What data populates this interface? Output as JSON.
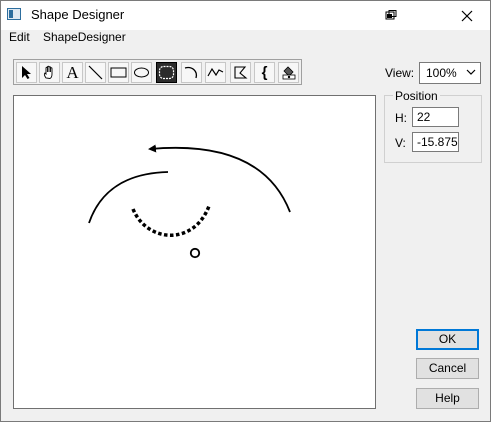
{
  "window": {
    "title": "Shape Designer"
  },
  "menu": {
    "items": [
      "Edit",
      "ShapeDesigner"
    ]
  },
  "toolbar": {
    "tools": [
      {
        "name": "select-arrow-icon"
      },
      {
        "name": "hand-icon"
      },
      {
        "name": "text-tool-icon",
        "glyph": "A"
      },
      {
        "name": "line-tool-icon"
      },
      {
        "name": "rectangle-tool-icon"
      },
      {
        "name": "ellipse-tool-icon"
      },
      {
        "name": "rounded-rect-tool-icon",
        "selected": true
      },
      {
        "name": "arc-tool-icon"
      },
      {
        "name": "polyline-tool-icon"
      },
      {
        "name": "polygon-tool-icon"
      },
      {
        "name": "brace-tool-icon",
        "glyph": "{"
      },
      {
        "name": "fill-tool-icon"
      }
    ]
  },
  "view": {
    "label": "View:",
    "value": "100%"
  },
  "position": {
    "legend": "Position",
    "h_label": "H:",
    "h_value": "22",
    "v_label": "V:",
    "v_value": "-15.875"
  },
  "buttons": {
    "ok": "OK",
    "cancel": "Cancel",
    "help": "Help"
  }
}
